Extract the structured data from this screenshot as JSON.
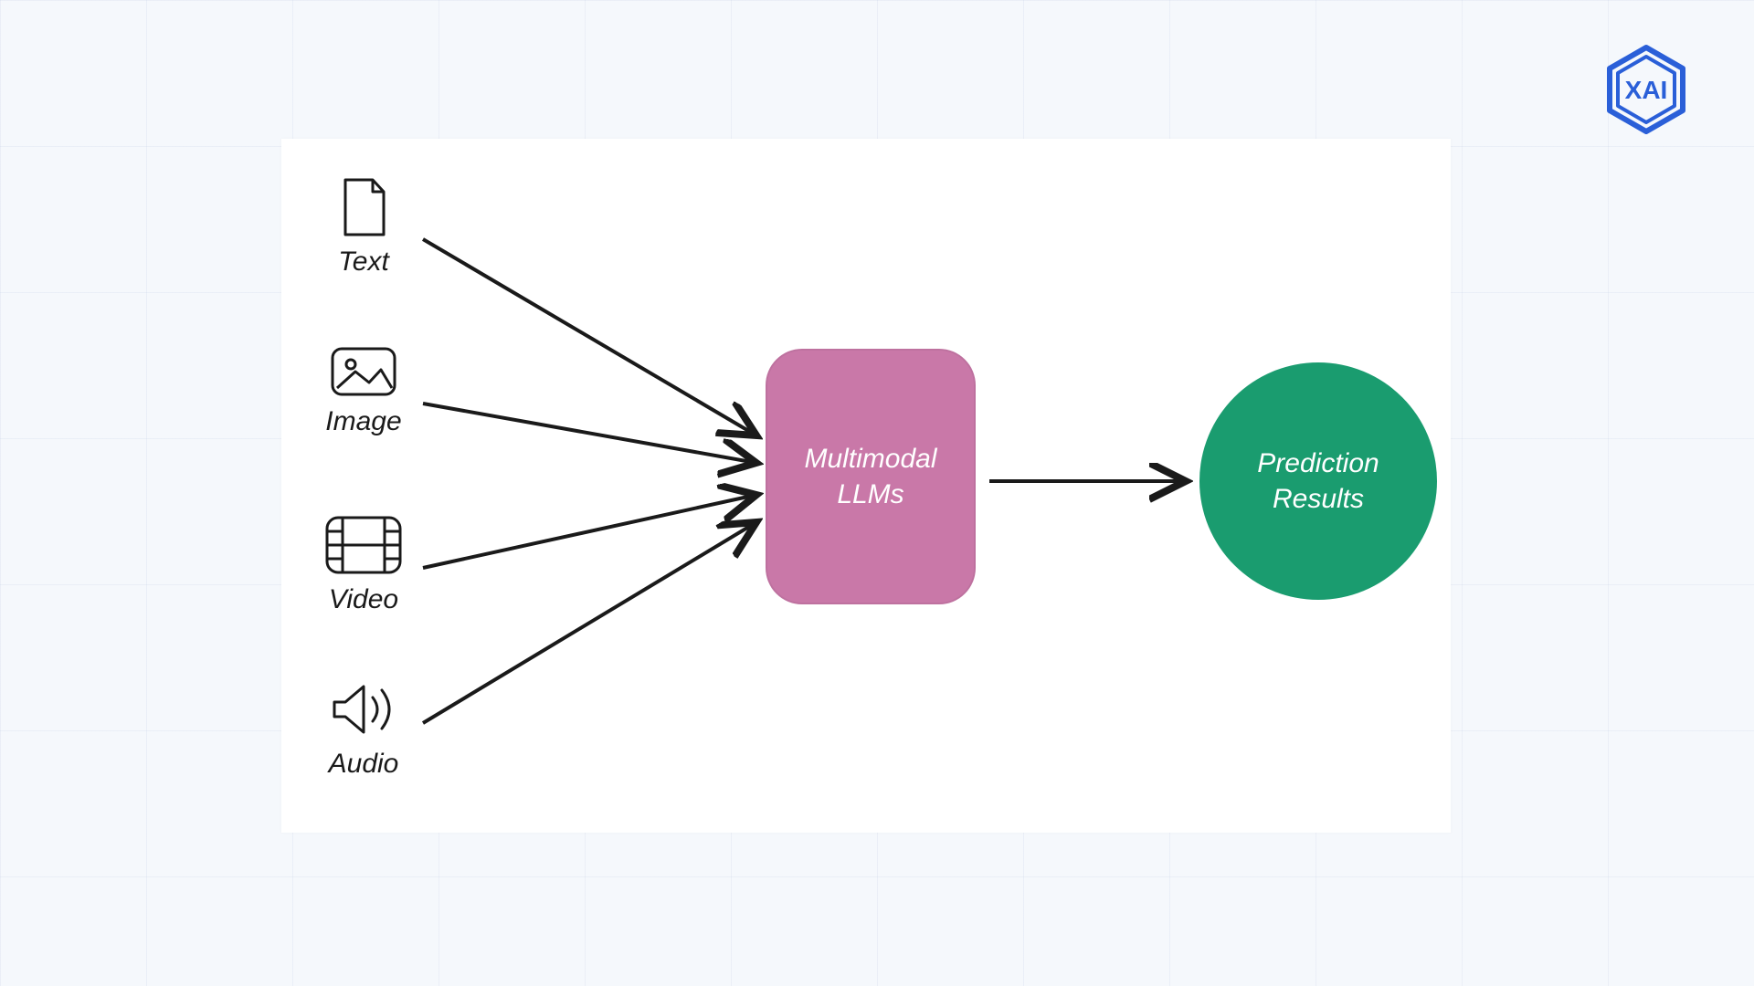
{
  "logo": {
    "label": "XAI"
  },
  "inputs": [
    {
      "name": "text",
      "label": "Text"
    },
    {
      "name": "image",
      "label": "Image"
    },
    {
      "name": "video",
      "label": "Video"
    },
    {
      "name": "audio",
      "label": "Audio"
    }
  ],
  "center": {
    "line1": "Multimodal",
    "line2": "LLMs"
  },
  "output": {
    "line1": "Prediction",
    "line2": "Results"
  },
  "colors": {
    "center": "#c978a8",
    "output": "#1a9c6f",
    "logo": "#2a5fd8",
    "stroke": "#1a1a1a"
  }
}
